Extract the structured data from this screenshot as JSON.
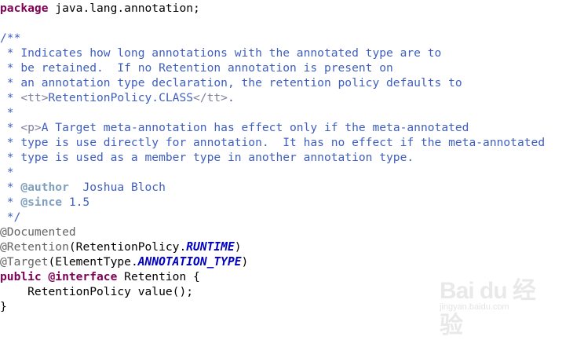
{
  "code": {
    "package_kw": "package",
    "package_name": " java.lang.annotation;",
    "doc_open": "/**",
    "doc_lines": [
      " * Indicates how long annotations with the annotated type are to",
      " * be retained.  If no Retention annotation is present on",
      " * an annotation type declaration, the retention policy defaults to",
      " * ",
      " *",
      " * ",
      " * type is use directly for annotation.  It has no effect if the meta-annotated",
      " * type is used as a member type in another annotation type.",
      " *"
    ],
    "doc_tt_open": "<tt>",
    "doc_tt_text": "RetentionPolicy.CLASS",
    "doc_tt_close": "</tt>",
    "doc_tt_end": ".",
    "doc_p_tag": "<p>",
    "doc_p_text": "A Target meta-annotation has effect only if the meta-annotated",
    "author_prefix": " * ",
    "author_tag": "@author",
    "author_name": "  Joshua Bloch",
    "since_prefix": " * ",
    "since_tag": "@since",
    "since_value": " 1.5",
    "doc_close": " */",
    "ann_documented": "@Documented",
    "ann_retention": "@Retention",
    "retention_open": "(RetentionPolicy.",
    "retention_const": "RUNTIME",
    "retention_close": ")",
    "ann_target": "@Target",
    "target_open": "(ElementType.",
    "target_const": "ANNOTATION_TYPE",
    "target_close": ")",
    "public_kw": "public",
    "interface_kw": " @interface",
    "interface_name": " Retention {",
    "method_line": "    RetentionPolicy value();",
    "closing_brace": "}"
  },
  "watermark": {
    "logo": "Bai du 经验",
    "subtitle": "jingyan.baidu.com"
  },
  "colors": {
    "keyword": "#7f0055",
    "annotation": "#646464",
    "javadoc": "#3f5fbf",
    "html_tag": "#7f7f9f",
    "javadoc_tag": "#7f9fbf",
    "constant": "#0000c0"
  }
}
